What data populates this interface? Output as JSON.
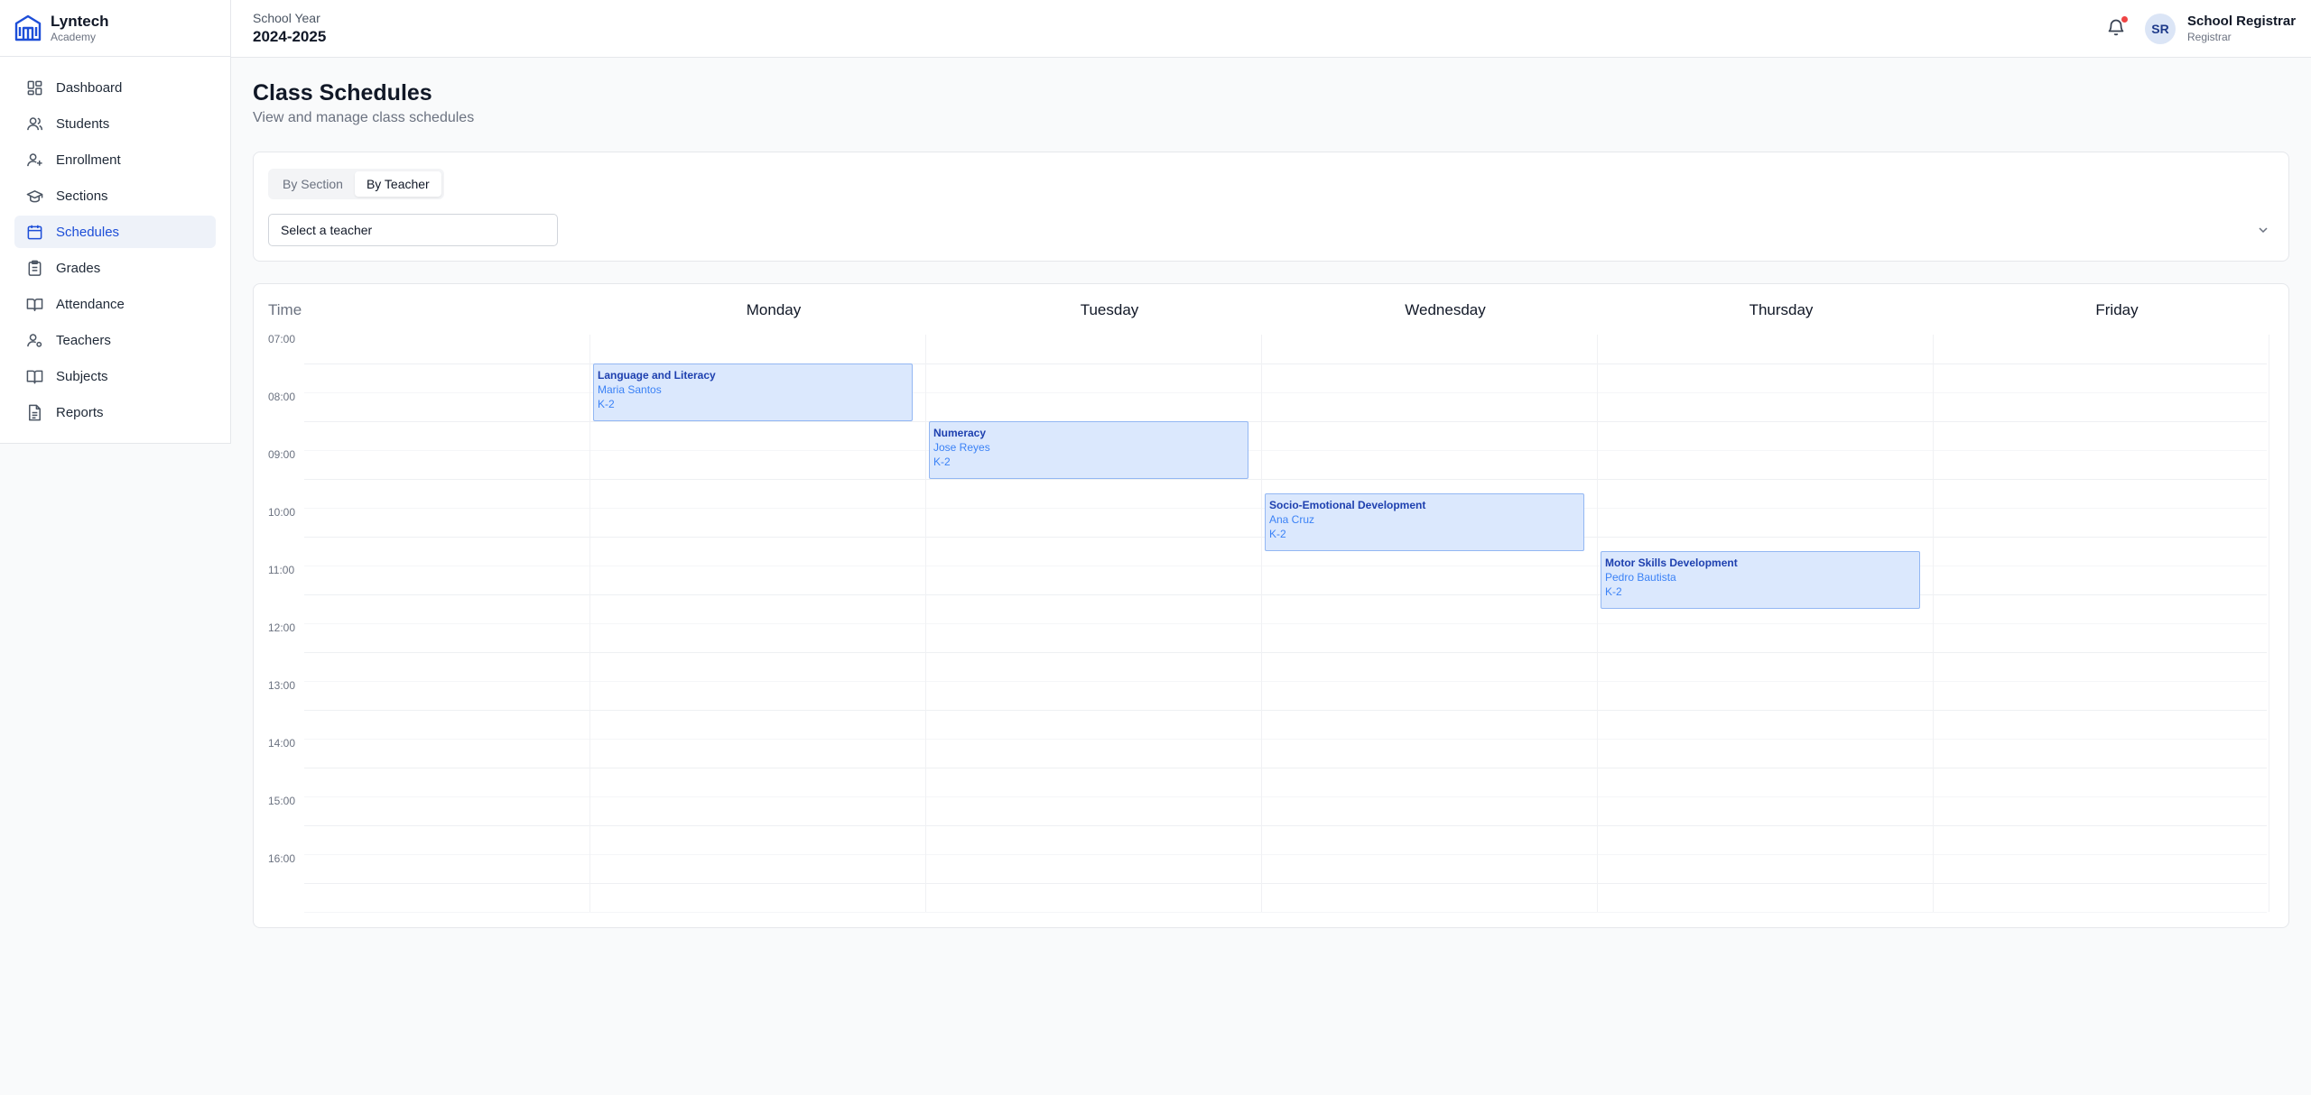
{
  "brand": {
    "name": "Lyntech",
    "sub": "Academy"
  },
  "nav": [
    {
      "label": "Dashboard",
      "icon": "dashboard-icon"
    },
    {
      "label": "Students",
      "icon": "users-icon"
    },
    {
      "label": "Enrollment",
      "icon": "user-plus-icon"
    },
    {
      "label": "Sections",
      "icon": "graduation-cap-icon"
    },
    {
      "label": "Schedules",
      "icon": "calendar-icon",
      "active": true
    },
    {
      "label": "Grades",
      "icon": "clipboard-icon"
    },
    {
      "label": "Attendance",
      "icon": "book-open-icon"
    },
    {
      "label": "Teachers",
      "icon": "user-cog-icon"
    },
    {
      "label": "Subjects",
      "icon": "book-icon"
    },
    {
      "label": "Reports",
      "icon": "file-text-icon"
    }
  ],
  "topbar": {
    "school_year_label": "School Year",
    "school_year_value": "2024-2025",
    "avatar_initials": "SR",
    "user_name": "School Registrar",
    "user_role": "Registrar"
  },
  "page": {
    "title": "Class Schedules",
    "subtitle": "View and manage class schedules"
  },
  "filters": {
    "tab_section": "By Section",
    "tab_teacher": "By Teacher",
    "active_tab": "By Teacher",
    "teacher_select_value": "Select a teacher"
  },
  "calendar": {
    "time_header": "Time",
    "days": [
      "Monday",
      "Tuesday",
      "Wednesday",
      "Thursday",
      "Friday"
    ],
    "hours": [
      "07:00",
      "08:00",
      "09:00",
      "10:00",
      "11:00",
      "12:00",
      "13:00",
      "14:00",
      "15:00",
      "16:00"
    ],
    "events": [
      {
        "title": "Language and Literacy",
        "teacher": "Maria Santos",
        "grade": "K-2",
        "day": "Monday",
        "start": "07:30",
        "end": "08:30"
      },
      {
        "title": "Numeracy",
        "teacher": "Jose Reyes",
        "grade": "K-2",
        "day": "Tuesday",
        "start": "08:30",
        "end": "09:30"
      },
      {
        "title": "Socio-Emotional Development",
        "teacher": "Ana Cruz",
        "grade": "K-2",
        "day": "Wednesday",
        "start": "09:45",
        "end": "10:45"
      },
      {
        "title": "Motor Skills Development",
        "teacher": "Pedro Bautista",
        "grade": "K-2",
        "day": "Thursday",
        "start": "10:45",
        "end": "11:45"
      }
    ]
  },
  "colors": {
    "accent": "#1d4ed8",
    "event_bg": "#dbe8fd",
    "event_border": "#93b7f3",
    "notification_dot": "#ef4444"
  }
}
